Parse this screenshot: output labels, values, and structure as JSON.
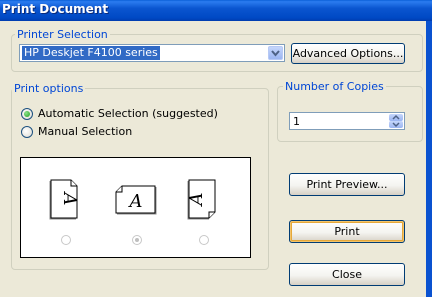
{
  "window": {
    "title": "Print Document"
  },
  "printer_selection": {
    "legend": "Printer Selection",
    "selected_printer": "HP Deskjet F4100 series",
    "advanced_label": "Advanced Options..."
  },
  "print_options": {
    "legend": "Print options",
    "options": [
      {
        "label": "Automatic Selection (suggested)",
        "checked": true
      },
      {
        "label": "Manual Selection",
        "checked": false
      }
    ],
    "orientation_previews": [
      {
        "icon": "portrait-page-icon",
        "glyph": "A",
        "checked": false
      },
      {
        "icon": "landscape-page-icon",
        "glyph": "A",
        "checked": true
      },
      {
        "icon": "portrait-rotated-page-icon",
        "glyph": "A",
        "checked": false
      }
    ]
  },
  "copies": {
    "legend": "Number of Copies",
    "value": "1"
  },
  "buttons": {
    "print_preview": "Print Preview...",
    "print": "Print",
    "close": "Close"
  }
}
